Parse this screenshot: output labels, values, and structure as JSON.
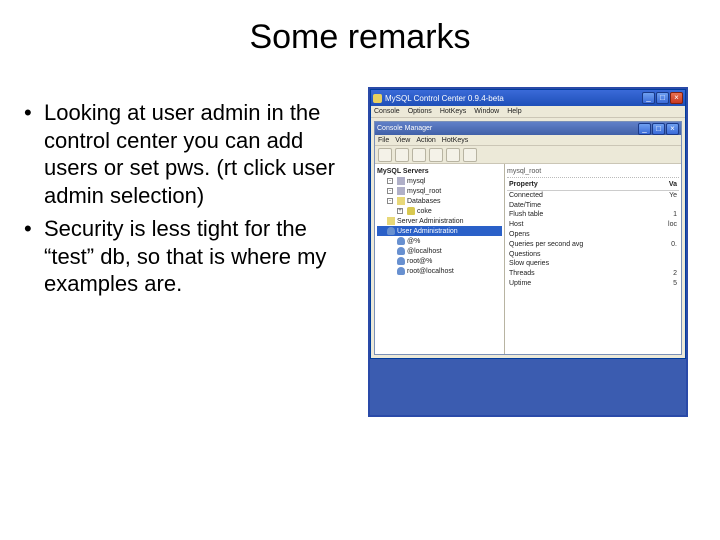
{
  "title": "Some remarks",
  "bullets": [
    "Looking at user admin in the control center you can add users or set pws. (rt click user admin selection)",
    "Security is less tight for the “test” db, so that is where my examples are."
  ],
  "screenshot": {
    "outer": {
      "title": "MySQL Control Center 0.9.4-beta",
      "menu": [
        "Console",
        "Options",
        "HotKeys",
        "Window",
        "Help"
      ],
      "buttons": {
        "min": "_",
        "max": "□",
        "close": "×"
      }
    },
    "inner": {
      "title": "Console Manager",
      "menu": [
        "File",
        "View",
        "Action",
        "HotKeys"
      ],
      "buttons": {
        "min": "_",
        "max": "□",
        "close": "×"
      }
    },
    "tree": {
      "root": "MySQL Servers",
      "items": [
        {
          "exp": "-",
          "label": "mysql",
          "ico": "serv",
          "lvl": 1
        },
        {
          "exp": "-",
          "label": "mysql_root",
          "ico": "serv",
          "lvl": 1
        },
        {
          "exp": "-",
          "label": "Databases",
          "ico": "folder",
          "lvl": 1
        },
        {
          "exp": "+",
          "label": "coke",
          "ico": "db",
          "lvl": 2
        },
        {
          "exp": "",
          "label": "Server Administration",
          "ico": "folder",
          "lvl": 1
        },
        {
          "exp": "",
          "label": "User Administration",
          "ico": "user",
          "lvl": 1,
          "selected": true
        },
        {
          "exp": "",
          "label": "@%",
          "ico": "user",
          "lvl": 2
        },
        {
          "exp": "",
          "label": "@localhost",
          "ico": "user",
          "lvl": 2
        },
        {
          "exp": "",
          "label": "root@%",
          "ico": "user",
          "lvl": 2
        },
        {
          "exp": "",
          "label": "root@localhost",
          "ico": "user",
          "lvl": 2
        }
      ]
    },
    "props": {
      "header_left": "Property",
      "header_right": "Va",
      "section": "mysql_root",
      "rows": [
        {
          "k": "Connected",
          "v": "Ye"
        },
        {
          "k": "Date/Time",
          "v": ""
        },
        {
          "k": "Flush table",
          "v": "1"
        },
        {
          "k": "Host",
          "v": "loc"
        },
        {
          "k": "Opens",
          "v": ""
        },
        {
          "k": "Queries per second avg",
          "v": "0."
        },
        {
          "k": "Questions",
          "v": ""
        },
        {
          "k": "Slow queries",
          "v": ""
        },
        {
          "k": "Threads",
          "v": "2"
        },
        {
          "k": "Uptime",
          "v": "5"
        }
      ]
    }
  }
}
